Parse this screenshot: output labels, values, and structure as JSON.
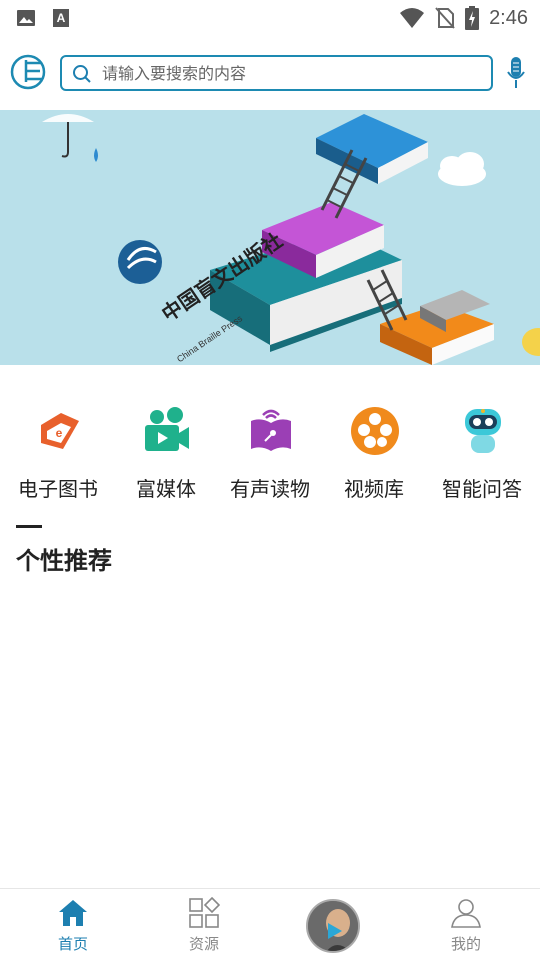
{
  "status_bar": {
    "time": "2:46",
    "left_icons": [
      "image-icon",
      "font-a-icon"
    ],
    "right_icons": [
      "wifi-icon",
      "no-sim-icon",
      "battery-icon"
    ]
  },
  "header": {
    "logo_icon": "press-logo-icon",
    "search": {
      "placeholder": "请输入要搜索的内容",
      "value": ""
    },
    "voice_icon": "microphone-icon"
  },
  "banner": {
    "title": "中国盲文出版社",
    "subtitle": "China Braille Press"
  },
  "categories": [
    {
      "label": "电子图书",
      "icon": "ebook-icon",
      "color": "#e8602c"
    },
    {
      "label": "富媒体",
      "icon": "rich-media-icon",
      "color": "#1fb18c"
    },
    {
      "label": "有声读物",
      "icon": "audiobook-icon",
      "color": "#9b3fb5"
    },
    {
      "label": "视频库",
      "icon": "film-reel-icon",
      "color": "#f08a1c"
    },
    {
      "label": "智能问答",
      "icon": "robot-icon",
      "color": "#3cc8d8"
    }
  ],
  "recommend": {
    "title": "个性推荐"
  },
  "bottom_nav": {
    "items": [
      {
        "label": "首页",
        "icon": "home-icon",
        "active": true
      },
      {
        "label": "资源",
        "icon": "grid-icon",
        "active": false
      },
      {
        "label": "",
        "icon": "media-player-avatar-icon",
        "active": false
      },
      {
        "label": "我的",
        "icon": "user-icon",
        "active": false
      }
    ],
    "active_color": "#1d7fb0",
    "inactive_color": "#888888"
  },
  "colors": {
    "accent": "#1d8ab2",
    "banner_bg": "#b9e0ea"
  }
}
